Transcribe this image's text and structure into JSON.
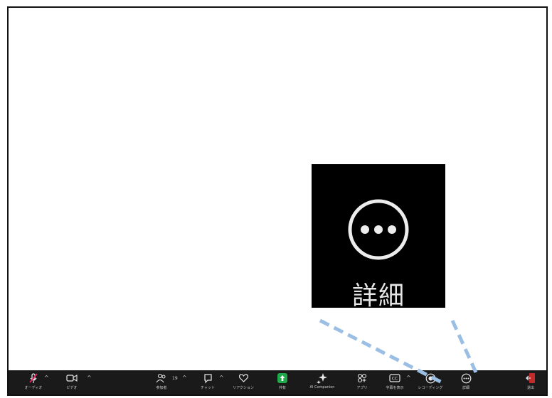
{
  "toolbar": {
    "audio_label": "オーディオ",
    "video_label": "ビデオ",
    "participants_label": "参加者",
    "participants_count": "19",
    "chat_label": "チャット",
    "reactions_label": "リアクション",
    "share_label": "共有",
    "ai_companion_label": "AI Companion",
    "apps_label": "アプリ",
    "captions_label": "字幕を表示",
    "recording_label": "レコーディング",
    "more_label": "詳細",
    "leave_label": "退出"
  },
  "callout": {
    "label": "詳細"
  },
  "colors": {
    "toolbar_bg": "#1a1a1a",
    "share_green": "#1ea94b",
    "mute_red": "#e0245e",
    "leave_red": "#c22b2b",
    "connector_blue": "#9bbfe4"
  }
}
